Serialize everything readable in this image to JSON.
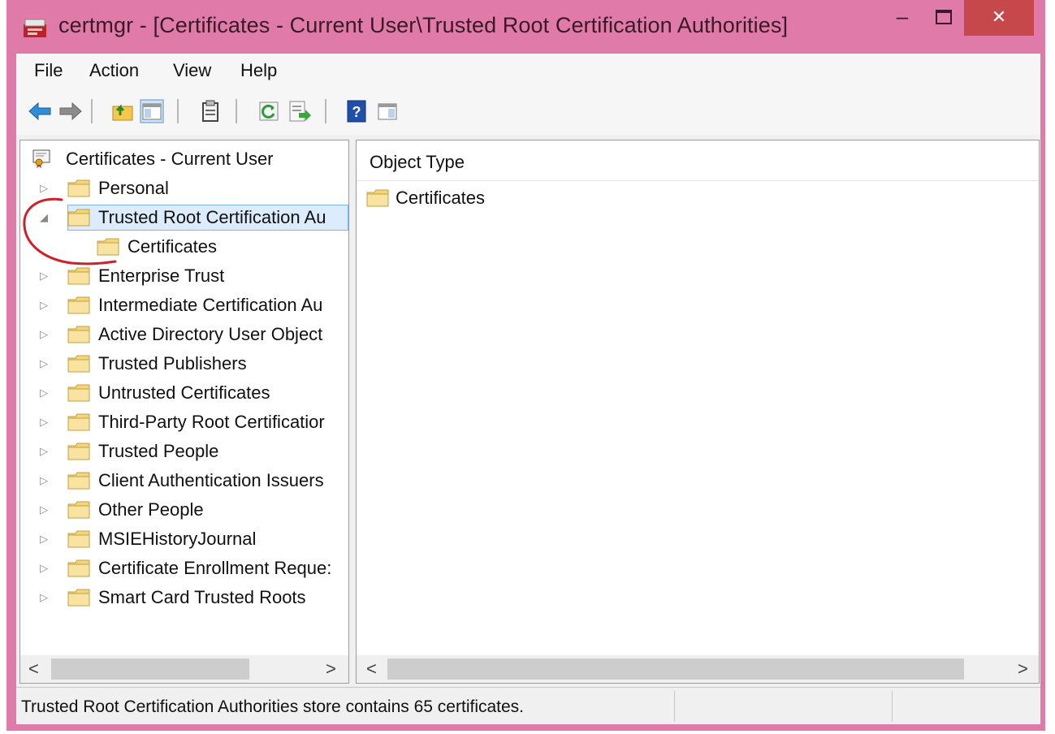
{
  "window": {
    "title": "certmgr - [Certificates - Current User\\Trusted Root Certification Authorities]",
    "controls": {
      "minimize": "–",
      "close": "✕"
    },
    "frame_color": "#e07aa8",
    "close_color": "#c7484a"
  },
  "menu": {
    "items": [
      "File",
      "Action",
      "View",
      "Help"
    ]
  },
  "toolbar": {
    "icons": [
      "back-arrow-icon",
      "forward-arrow-icon",
      "up-folder-icon",
      "show-hide-tree-icon",
      "properties-icon",
      "refresh-icon",
      "export-list-icon",
      "help-icon",
      "show-hide-action-pane-icon"
    ]
  },
  "tree": {
    "root": "Certificates - Current User",
    "items": [
      {
        "label": "Personal",
        "expander": "▷"
      },
      {
        "label": "Trusted Root Certification Au",
        "expander": "◢",
        "selected": true
      },
      {
        "label": "Certificates",
        "expander": ""
      },
      {
        "label": "Enterprise Trust",
        "expander": "▷"
      },
      {
        "label": "Intermediate Certification Au",
        "expander": "▷"
      },
      {
        "label": "Active Directory User Object",
        "expander": "▷"
      },
      {
        "label": "Trusted Publishers",
        "expander": "▷"
      },
      {
        "label": "Untrusted Certificates",
        "expander": "▷"
      },
      {
        "label": "Third-Party Root Certificatior",
        "expander": "▷"
      },
      {
        "label": "Trusted People",
        "expander": "▷"
      },
      {
        "label": "Client Authentication Issuers",
        "expander": "▷"
      },
      {
        "label": "Other People",
        "expander": "▷"
      },
      {
        "label": "MSIEHistoryJournal",
        "expander": "▷"
      },
      {
        "label": "Certificate Enrollment Reque:",
        "expander": "▷"
      },
      {
        "label": "Smart Card Trusted Roots",
        "expander": "▷"
      }
    ],
    "scroll": {
      "left": "<",
      "right": ">"
    }
  },
  "list": {
    "column_header": "Object Type",
    "items": [
      "Certificates"
    ],
    "scroll": {
      "left": "<",
      "right": ">"
    }
  },
  "status": {
    "text": "Trusted Root Certification Authorities store contains 65 certificates."
  }
}
